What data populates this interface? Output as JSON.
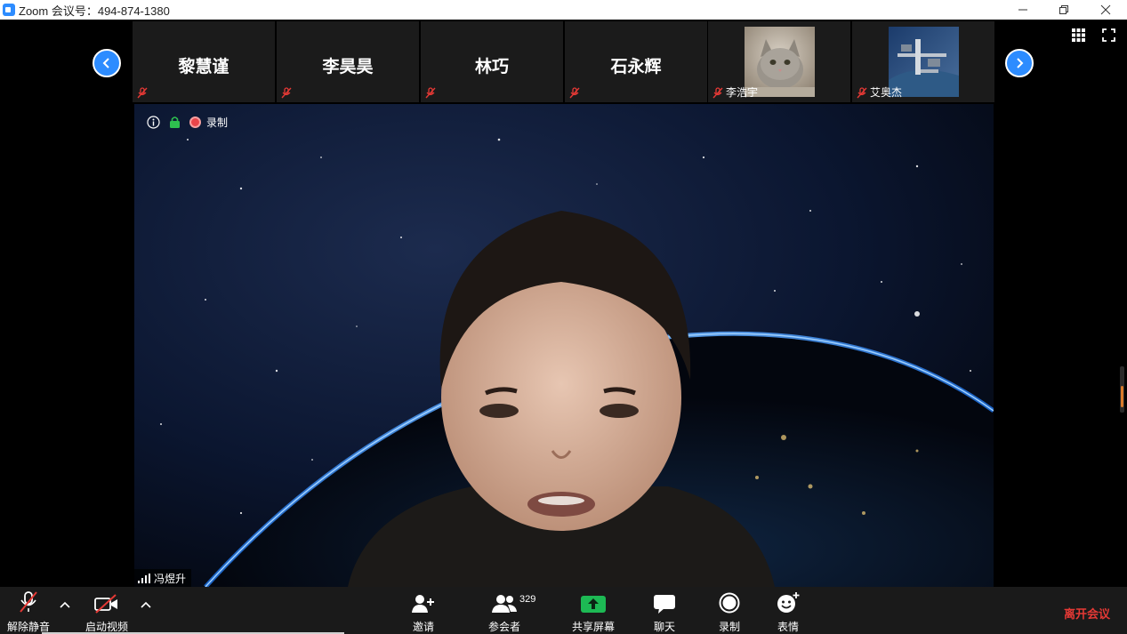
{
  "window": {
    "title": "Zoom 会议号：494-874-1380"
  },
  "strip": {
    "participants": [
      {
        "name": "黎慧谨",
        "type": "name"
      },
      {
        "name": "李昊昊",
        "type": "name"
      },
      {
        "name": "林巧",
        "type": "name"
      },
      {
        "name": "石永辉",
        "type": "name"
      },
      {
        "name": "李浩宇",
        "type": "photo",
        "photo": "cat-photo"
      },
      {
        "name": "艾奥杰",
        "type": "photo",
        "photo": "space-station-photo"
      }
    ]
  },
  "video": {
    "recording_label": "录制",
    "speaker_name": "冯煜升"
  },
  "toolbar": {
    "unmute_label": "解除静音",
    "start_video_label": "启动视频",
    "invite_label": "邀请",
    "participants_label": "参会者",
    "participants_count": "329",
    "share_label": "共享屏幕",
    "chat_label": "聊天",
    "record_label": "录制",
    "reactions_label": "表情",
    "leave_label": "离开会议"
  },
  "colors": {
    "accent": "#2d8cff",
    "share_green": "#1db954",
    "leave_red": "#e53935",
    "mute_red": "#e53935"
  }
}
